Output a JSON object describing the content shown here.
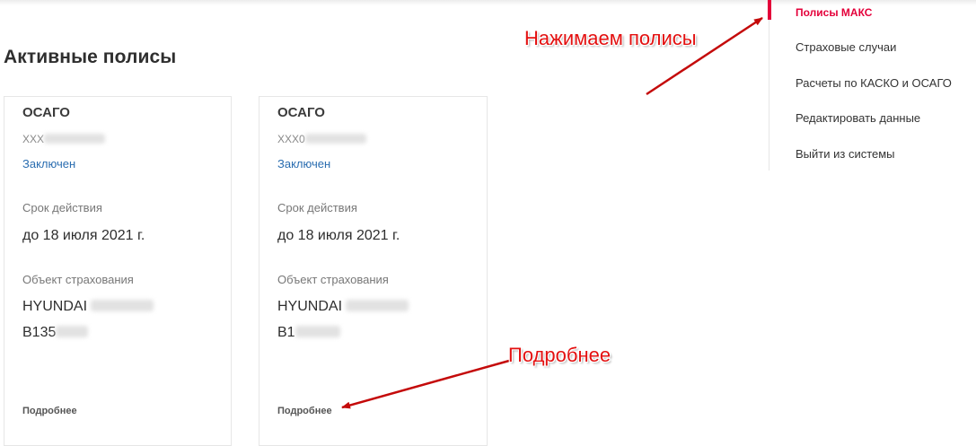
{
  "page": {
    "title": "Активные полисы"
  },
  "cards": [
    {
      "type": "ОСАГО",
      "number_prefix": "XXX",
      "status": "Заключен",
      "term_label": "Срок действия",
      "term_value": "до 18 июля 2021 г.",
      "object_label": "Объект страхования",
      "vehicle": "HYUNDAI",
      "plate_prefix": "B135",
      "details": "Подробнее"
    },
    {
      "type": "ОСАГО",
      "number_prefix": "XXX0",
      "status": "Заключен",
      "term_label": "Срок действия",
      "term_value": "до 18 июля 2021 г.",
      "object_label": "Объект страхования",
      "vehicle": "HYUNDAI",
      "plate_prefix": "B1",
      "details": "Подробнее"
    }
  ],
  "sidebar": {
    "items": [
      {
        "label": "Полисы МАКС",
        "active": true
      },
      {
        "label": "Страховые случаи"
      },
      {
        "label": "Расчеты по КАСКО и ОСАГО"
      },
      {
        "label": "Редактировать данные"
      },
      {
        "label": "Выйти из системы"
      }
    ],
    "accent_color": "#e4003a"
  },
  "annotations": {
    "policies_hint": "Нажимаем полисы",
    "details_hint": "Подробнее",
    "color": "#e31010"
  }
}
